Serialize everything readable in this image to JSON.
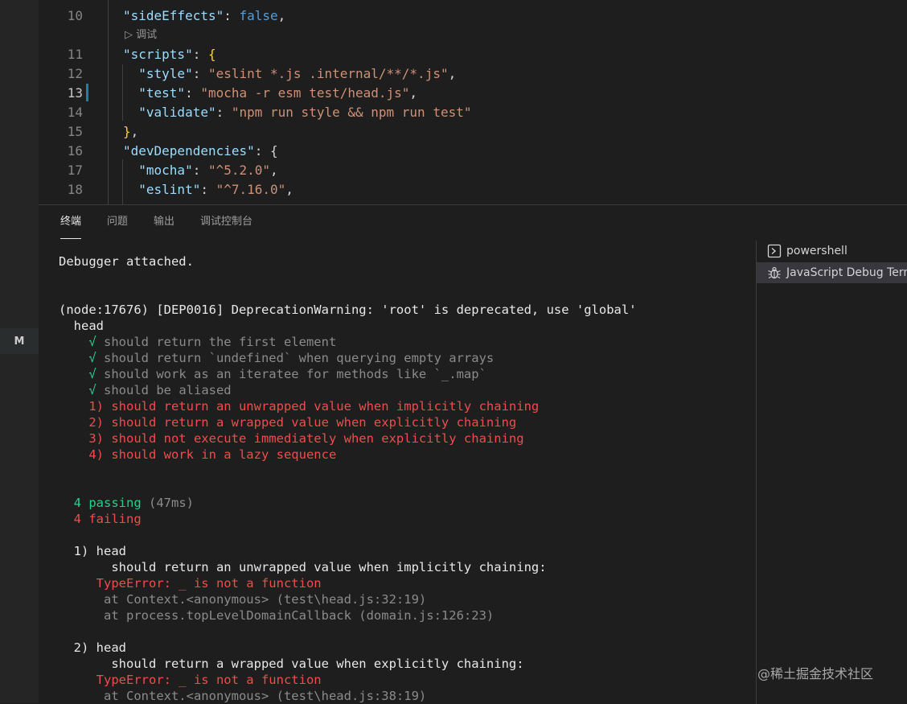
{
  "activity": {
    "badge": "M"
  },
  "editor": {
    "codelens": "▷ 调试",
    "lines": [
      {
        "num": "10",
        "tokens": [
          [
            "k",
            "\"sideEffects\""
          ],
          [
            "p",
            ": "
          ],
          [
            "b",
            "false"
          ],
          [
            "p",
            ","
          ]
        ]
      },
      {
        "num": "11",
        "tokens": [
          [
            "k",
            "\"scripts\""
          ],
          [
            "p",
            ": "
          ],
          [
            "y",
            "{"
          ]
        ]
      },
      {
        "num": "12",
        "tokens": [
          [
            "p",
            "  "
          ],
          [
            "k",
            "\"style\""
          ],
          [
            "p",
            ": "
          ],
          [
            "s",
            "\"eslint *.js .internal/**/*.js\""
          ],
          [
            "p",
            ","
          ]
        ]
      },
      {
        "num": "13",
        "tokens": [
          [
            "p",
            "  "
          ],
          [
            "k",
            "\"test\""
          ],
          [
            "p",
            ": "
          ],
          [
            "s",
            "\"mocha -r esm test/head.js\""
          ],
          [
            "p",
            ","
          ]
        ]
      },
      {
        "num": "14",
        "tokens": [
          [
            "p",
            "  "
          ],
          [
            "k",
            "\"validate\""
          ],
          [
            "p",
            ": "
          ],
          [
            "s",
            "\"npm run style && npm run test\""
          ]
        ]
      },
      {
        "num": "15",
        "tokens": [
          [
            "y",
            "}"
          ],
          [
            "p",
            ","
          ]
        ]
      },
      {
        "num": "16",
        "tokens": [
          [
            "k",
            "\"devDependencies\""
          ],
          [
            "p",
            ": {"
          ]
        ]
      },
      {
        "num": "17",
        "tokens": [
          [
            "p",
            "  "
          ],
          [
            "k",
            "\"mocha\""
          ],
          [
            "p",
            ": "
          ],
          [
            "s",
            "\"^5.2.0\""
          ],
          [
            "p",
            ","
          ]
        ]
      },
      {
        "num": "18",
        "tokens": [
          [
            "p",
            "  "
          ],
          [
            "k",
            "\"eslint\""
          ],
          [
            "p",
            ": "
          ],
          [
            "s",
            "\"^7.16.0\""
          ],
          [
            "p",
            ","
          ]
        ]
      }
    ]
  },
  "panel": {
    "tabs": [
      {
        "id": "terminal",
        "label": "终端",
        "active": true
      },
      {
        "id": "problems",
        "label": "问题",
        "active": false
      },
      {
        "id": "output",
        "label": "输出",
        "active": false
      },
      {
        "id": "debug-console",
        "label": "调试控制台",
        "active": false
      }
    ]
  },
  "terminal": {
    "lines": [
      {
        "text": "Debugger attached.",
        "color": "white"
      },
      {
        "text": "",
        "color": "white"
      },
      {
        "text": "",
        "color": "white"
      },
      {
        "text": "(node:17676) [DEP0016] DeprecationWarning: 'root' is deprecated, use 'global'",
        "color": "white"
      },
      {
        "text": "  head",
        "color": "white"
      },
      {
        "mark": "    √ ",
        "text": "should return the first element",
        "color": "gray"
      },
      {
        "mark": "    √ ",
        "text": "should return `undefined` when querying empty arrays",
        "color": "gray"
      },
      {
        "mark": "    √ ",
        "text": "should work as an iteratee for methods like `_.map`",
        "color": "gray"
      },
      {
        "mark": "    √ ",
        "text": "should be aliased",
        "color": "gray"
      },
      {
        "text": "    1) should return an unwrapped value when implicitly chaining",
        "color": "red"
      },
      {
        "text": "    2) should return a wrapped value when explicitly chaining",
        "color": "red"
      },
      {
        "text": "    3) should not execute immediately when explicitly chaining",
        "color": "red"
      },
      {
        "text": "    4) should work in a lazy sequence",
        "color": "red"
      },
      {
        "text": "",
        "color": "white"
      },
      {
        "text": "",
        "color": "white"
      },
      {
        "text": "  4 passing",
        "extra": " (47ms)",
        "color": "green"
      },
      {
        "text": "  4 failing",
        "color": "red"
      },
      {
        "text": "",
        "color": "white"
      },
      {
        "text": "  1) head",
        "color": "white"
      },
      {
        "text": "       should return an unwrapped value when implicitly chaining:",
        "color": "white"
      },
      {
        "text": "     TypeError: _ is not a function",
        "color": "red"
      },
      {
        "text": "      at Context.<anonymous> (test\\head.js:32:19)",
        "color": "gray"
      },
      {
        "text": "      at process.topLevelDomainCallback (domain.js:126:23)",
        "color": "gray"
      },
      {
        "text": "",
        "color": "white"
      },
      {
        "text": "  2) head",
        "color": "white"
      },
      {
        "text": "       should return a wrapped value when explicitly chaining:",
        "color": "white"
      },
      {
        "text": "     TypeError: _ is not a function",
        "color": "red"
      },
      {
        "text": "      at Context.<anonymous> (test\\head.js:38:19)",
        "color": "gray"
      }
    ]
  },
  "terminal_list": [
    {
      "label": "powershell",
      "icon": "terminal-icon",
      "selected": false
    },
    {
      "label": "JavaScript Debug Terminal",
      "icon": "bug-icon",
      "selected": true
    }
  ],
  "watermark": "@稀土掘金技术社区",
  "colors": {
    "background": "#1e1e1e",
    "pass": "#23d18b",
    "fail": "#f14c4c",
    "json_key": "#9cdcfe",
    "json_string": "#ce9178"
  }
}
